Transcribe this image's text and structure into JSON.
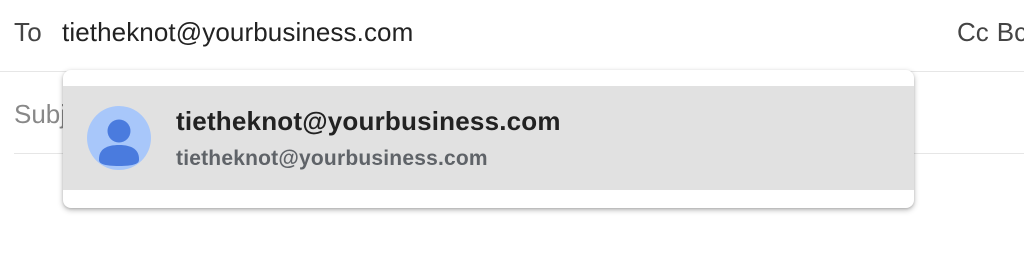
{
  "compose": {
    "to_label": "To",
    "to_value": "tietheknot@yourbusiness.com",
    "cc_label": "Cc",
    "bcc_label": "Bcc",
    "subject_placeholder": "Subject"
  },
  "suggestion": {
    "name": "tietheknot@yourbusiness.com",
    "email": "tietheknot@yourbusiness.com",
    "avatar_icon": "person-icon",
    "colors": {
      "highlight": "#e1e1e1",
      "avatar_bg": "#a8c7fa",
      "avatar_fg": "#4a7bde"
    }
  }
}
